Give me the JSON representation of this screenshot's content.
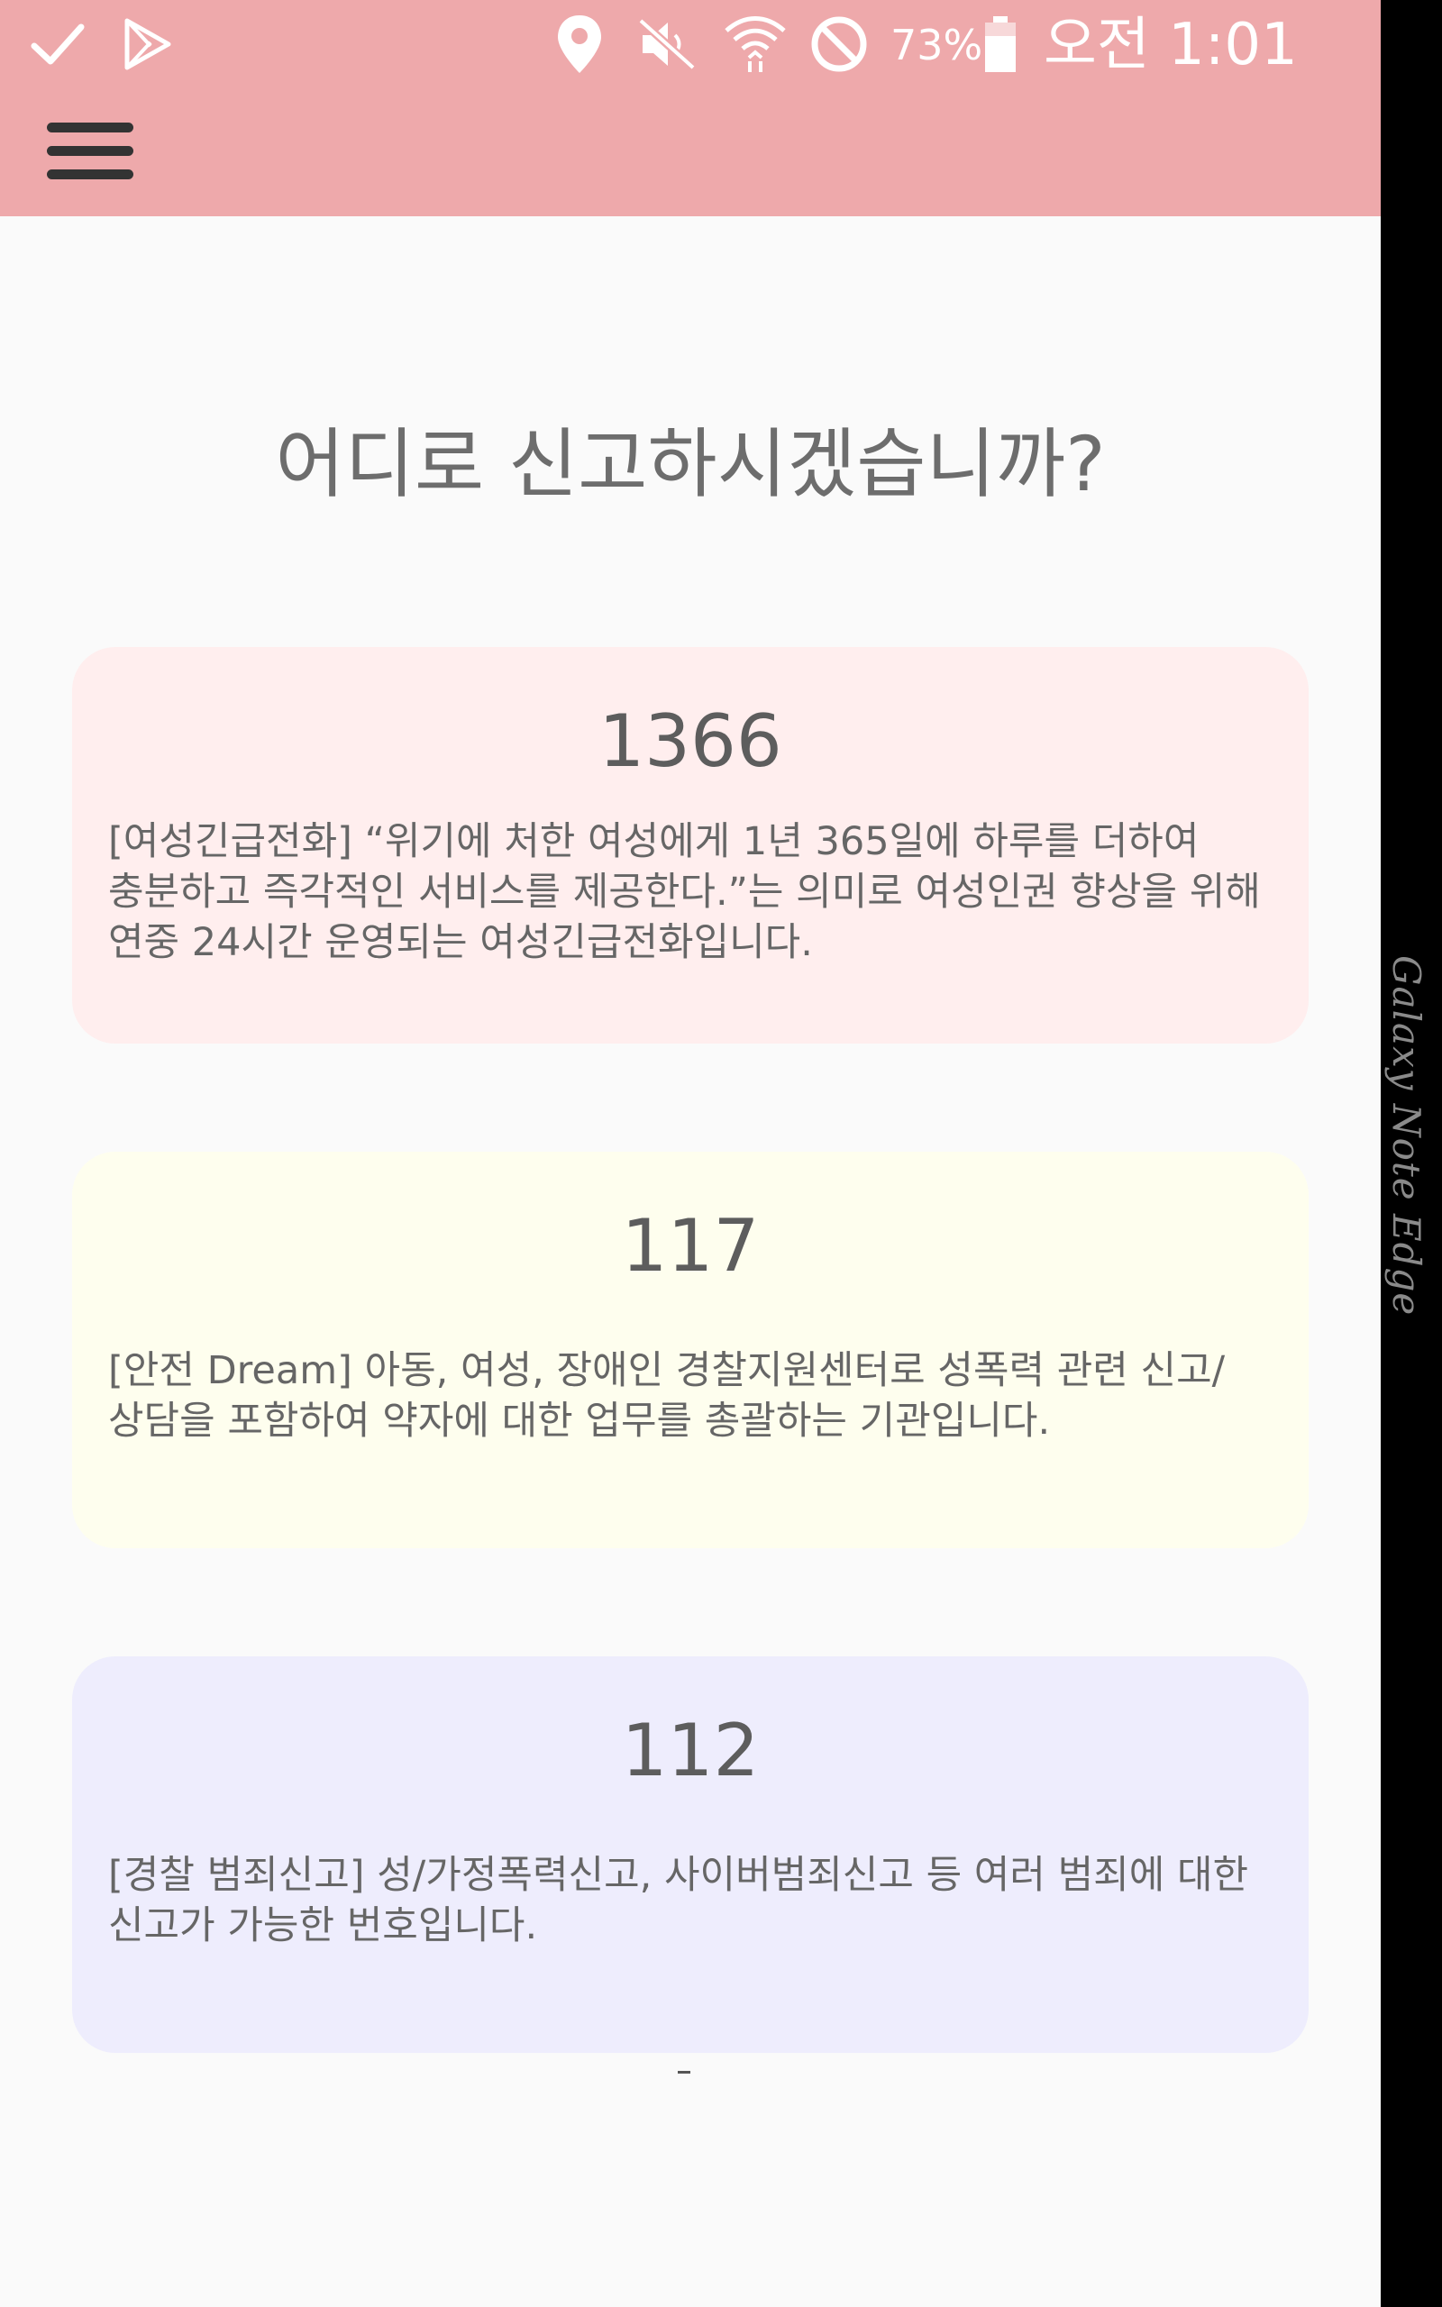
{
  "status_bar": {
    "battery_percent": "73%",
    "time": "오전 1:01",
    "icons": [
      "check-icon",
      "play-store-icon",
      "location-icon",
      "mute-icon",
      "wifi-icon",
      "do-not-disturb-icon",
      "battery-icon"
    ]
  },
  "app_bar": {
    "menu_icon": "hamburger-menu-icon"
  },
  "main": {
    "title": "어디로 신고하시겠습니까?",
    "cards": [
      {
        "number": "1366",
        "description": "[여성긴급전화] “위기에 처한 여성에게 1년 365일에 하루를 더하여 충분하고 즉각적인 서비스를 제공한다.”는 의미로 여성인권 향상을 위해 연중 24시간 운영되는 여성긴급전화입니다.",
        "color": "#ffeeee"
      },
      {
        "number": "117",
        "description": "[안전 Dream] 아동, 여성, 장애인 경찰지원센터로 성폭력 관련 신고/상담을 포함하여 약자에 대한 업무를 총괄하는 기관입니다.",
        "color": "#fefeee"
      },
      {
        "number": "112",
        "description": "[경찰 범죄신고] 성/가정폭력신고, 사이버범죄신고 등 여러 범죄에 대한 신고가 가능한 번호입니다.",
        "color": "#eeedfd"
      }
    ]
  },
  "device": {
    "edge_label": "Galaxy Note Edge"
  },
  "colors": {
    "app_bar": "#eea9ab",
    "background": "#fafafa",
    "title_text": "#6d6d6d"
  }
}
